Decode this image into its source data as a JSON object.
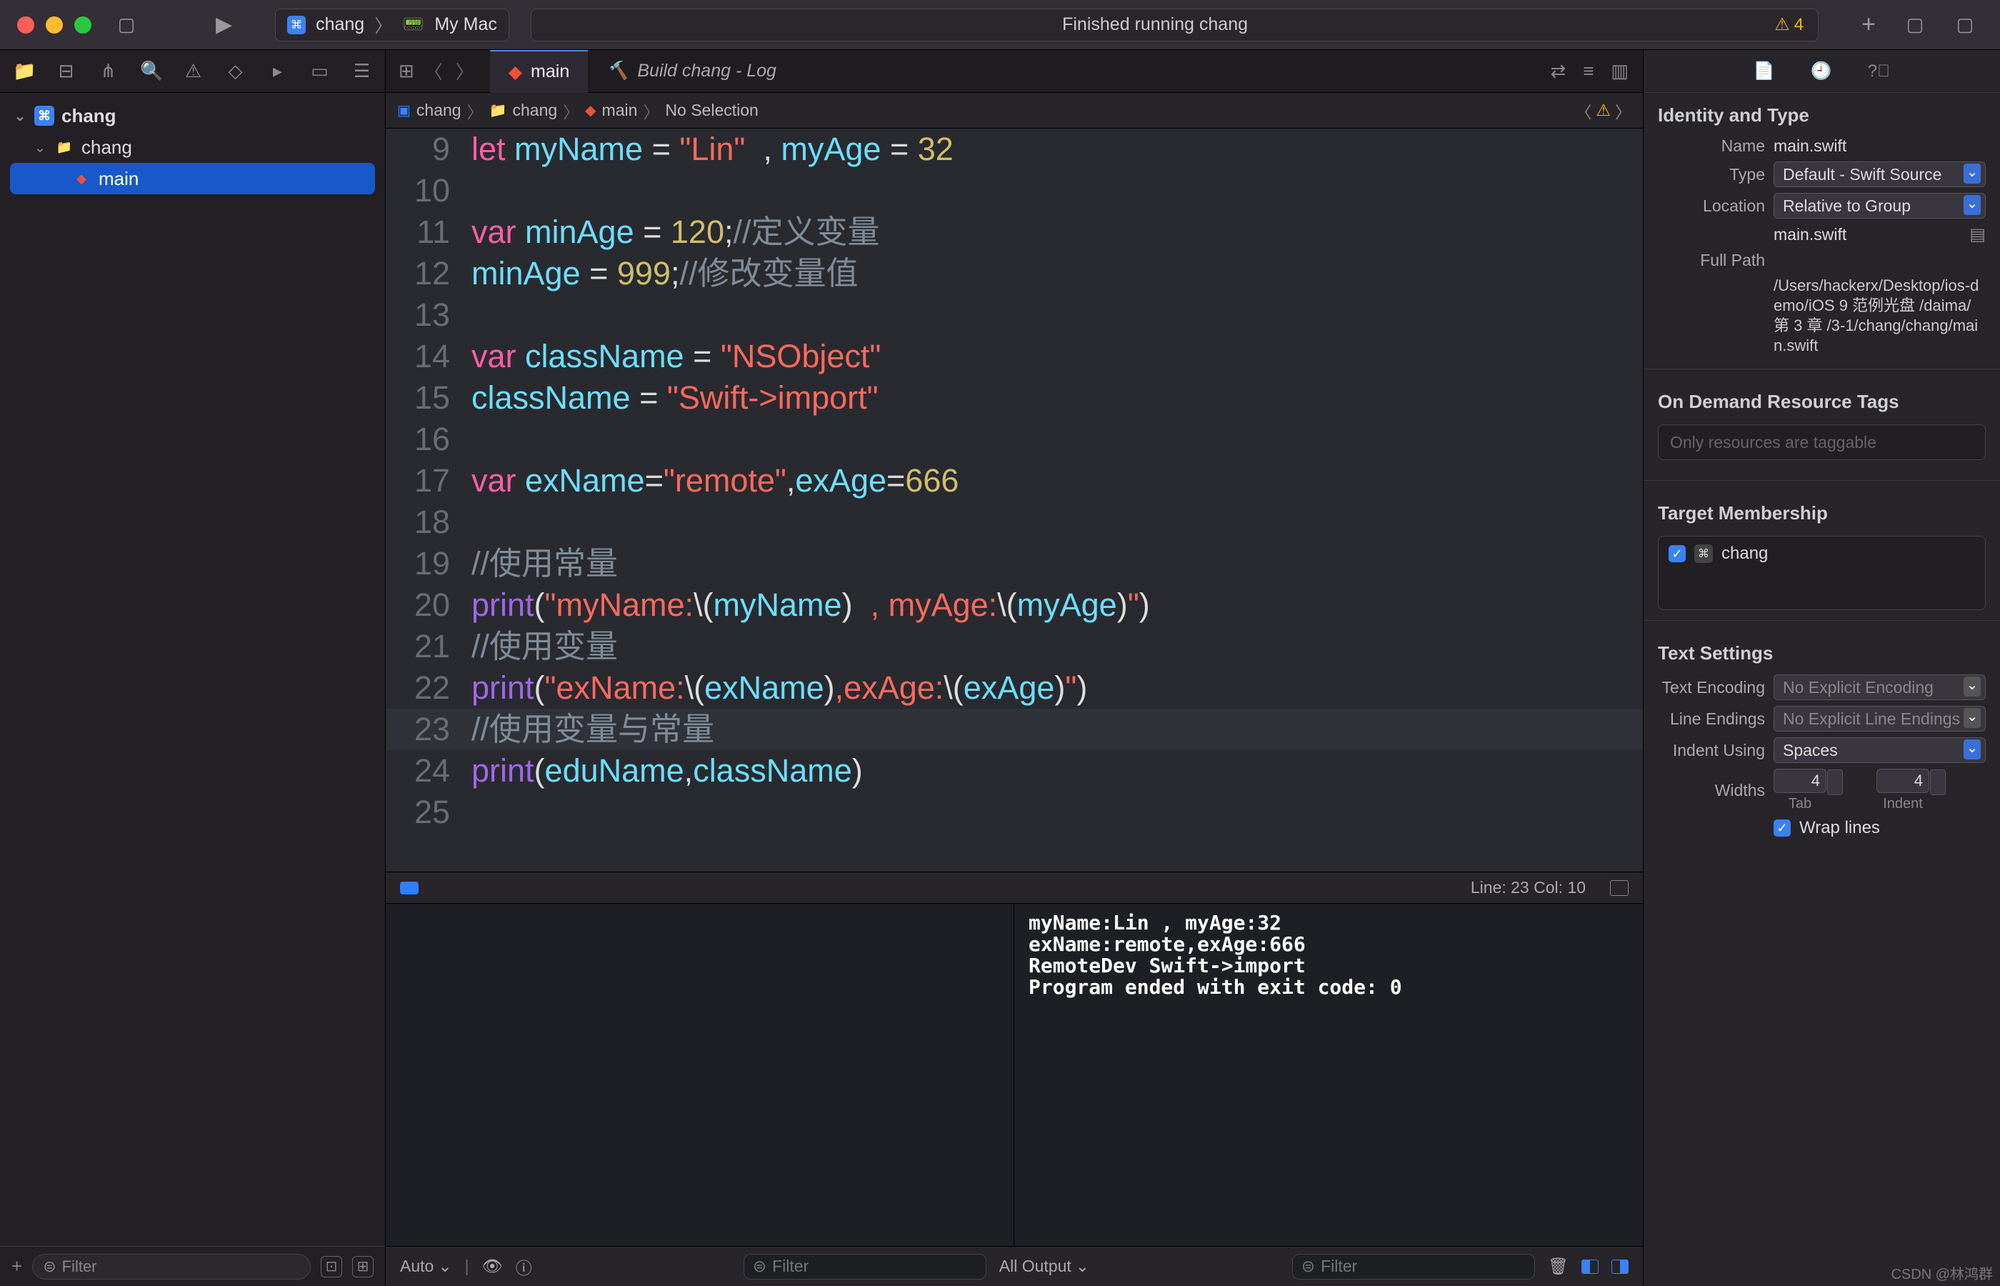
{
  "topbar": {
    "scheme_name": "chang",
    "scheme_target": "My Mac",
    "status_text": "Finished running chang",
    "warning_count": "4"
  },
  "sidebar": {
    "project": "chang",
    "folder": "chang",
    "file": "main",
    "filter_placeholder": "Filter"
  },
  "tabs": {
    "active": "main",
    "build_log": "Build chang - Log"
  },
  "breadcrumb": {
    "p0": "chang",
    "p1": "chang",
    "p2": "main",
    "p3": "No Selection"
  },
  "code": {
    "lines": [
      {
        "n": "9",
        "seg": [
          [
            "kw",
            "let "
          ],
          [
            "id",
            "myName"
          ],
          [
            "pl",
            " = "
          ],
          [
            "str",
            "\"Lin\""
          ],
          [
            "pl",
            "  , "
          ],
          [
            "id",
            "myAge"
          ],
          [
            "pl",
            " = "
          ],
          [
            "num",
            "32"
          ]
        ]
      },
      {
        "n": "10",
        "seg": []
      },
      {
        "n": "11",
        "seg": [
          [
            "kw",
            "var "
          ],
          [
            "id",
            "minAge"
          ],
          [
            "pl",
            " = "
          ],
          [
            "num",
            "120"
          ],
          [
            "pl",
            ";"
          ],
          [
            "cm",
            "//定义变量"
          ]
        ]
      },
      {
        "n": "12",
        "seg": [
          [
            "id",
            "minAge"
          ],
          [
            "pl",
            " = "
          ],
          [
            "num",
            "999"
          ],
          [
            "pl",
            ";"
          ],
          [
            "cm",
            "//修改变量值"
          ]
        ]
      },
      {
        "n": "13",
        "seg": []
      },
      {
        "n": "14",
        "seg": [
          [
            "kw",
            "var "
          ],
          [
            "id",
            "className"
          ],
          [
            "pl",
            " = "
          ],
          [
            "str",
            "\"NSObject\""
          ]
        ]
      },
      {
        "n": "15",
        "seg": [
          [
            "id",
            "className"
          ],
          [
            "pl",
            " = "
          ],
          [
            "str",
            "\"Swift->import\""
          ]
        ]
      },
      {
        "n": "16",
        "seg": []
      },
      {
        "n": "17",
        "seg": [
          [
            "kw",
            "var "
          ],
          [
            "id",
            "exName"
          ],
          [
            "pl",
            "="
          ],
          [
            "str",
            "\"remote\""
          ],
          [
            "pl",
            ","
          ],
          [
            "id",
            "exAge"
          ],
          [
            "pl",
            "="
          ],
          [
            "num",
            "666"
          ]
        ]
      },
      {
        "n": "18",
        "seg": []
      },
      {
        "n": "19",
        "seg": [
          [
            "cm",
            "//使用常量"
          ]
        ]
      },
      {
        "n": "20",
        "seg": [
          [
            "fn",
            "print"
          ],
          [
            "pl",
            "("
          ],
          [
            "str",
            "\"myName:"
          ],
          [
            "pl",
            "\\("
          ],
          [
            "id",
            "myName"
          ],
          [
            "pl",
            ")"
          ],
          [
            "str",
            "  , myAge:"
          ],
          [
            "pl",
            "\\("
          ],
          [
            "id",
            "myAge"
          ],
          [
            "pl",
            ")"
          ],
          [
            "str",
            "\""
          ],
          [
            "pl",
            ")"
          ]
        ]
      },
      {
        "n": "21",
        "seg": [
          [
            "cm",
            "//使用变量"
          ]
        ]
      },
      {
        "n": "22",
        "seg": [
          [
            "fn",
            "print"
          ],
          [
            "pl",
            "("
          ],
          [
            "str",
            "\"exName:"
          ],
          [
            "pl",
            "\\("
          ],
          [
            "id",
            "exName"
          ],
          [
            "pl",
            ")"
          ],
          [
            "str",
            ",exAge:"
          ],
          [
            "pl",
            "\\("
          ],
          [
            "id",
            "exAge"
          ],
          [
            "pl",
            ")"
          ],
          [
            "str",
            "\""
          ],
          [
            "pl",
            ")"
          ]
        ]
      },
      {
        "n": "23",
        "seg": [
          [
            "cm",
            "//使用变量与常量"
          ]
        ],
        "hl": true
      },
      {
        "n": "24",
        "seg": [
          [
            "fn",
            "print"
          ],
          [
            "pl",
            "("
          ],
          [
            "id",
            "eduName"
          ],
          [
            "pl",
            ","
          ],
          [
            "id",
            "className"
          ],
          [
            "pl",
            ")"
          ]
        ]
      },
      {
        "n": "25",
        "seg": []
      }
    ]
  },
  "statusline": {
    "pos": "Line: 23  Col: 10"
  },
  "console": {
    "out": "myName:Lin , myAge:32\nexName:remote,exAge:666\nRemoteDev Swift->import\nProgram ended with exit code: 0",
    "auto": "Auto",
    "all_output": "All Output",
    "filter_placeholder": "Filter",
    "filter_placeholder2": "Filter"
  },
  "inspector": {
    "identity_title": "Identity and Type",
    "name_label": "Name",
    "name_value": "main.swift",
    "type_label": "Type",
    "type_value": "Default - Swift Source",
    "location_label": "Location",
    "location_value": "Relative to Group",
    "location_file": "main.swift",
    "fullpath_label": "Full Path",
    "fullpath_value": "/Users/hackerx/Desktop/ios-demo/iOS 9 范例光盘 /daima/第 3 章 /3-1/chang/chang/main.swift",
    "ondemand_title": "On Demand Resource Tags",
    "ondemand_placeholder": "Only resources are taggable",
    "target_title": "Target Membership",
    "target_name": "chang",
    "text_title": "Text Settings",
    "enc_label": "Text Encoding",
    "enc_value": "No Explicit Encoding",
    "le_label": "Line Endings",
    "le_value": "No Explicit Line Endings",
    "indent_label": "Indent Using",
    "indent_value": "Spaces",
    "widths_label": "Widths",
    "tab_value": "4",
    "indent_value2": "4",
    "tab_sub": "Tab",
    "indent_sub": "Indent",
    "wrap_label": "Wrap lines"
  },
  "watermark": "CSDN @林鸿群"
}
